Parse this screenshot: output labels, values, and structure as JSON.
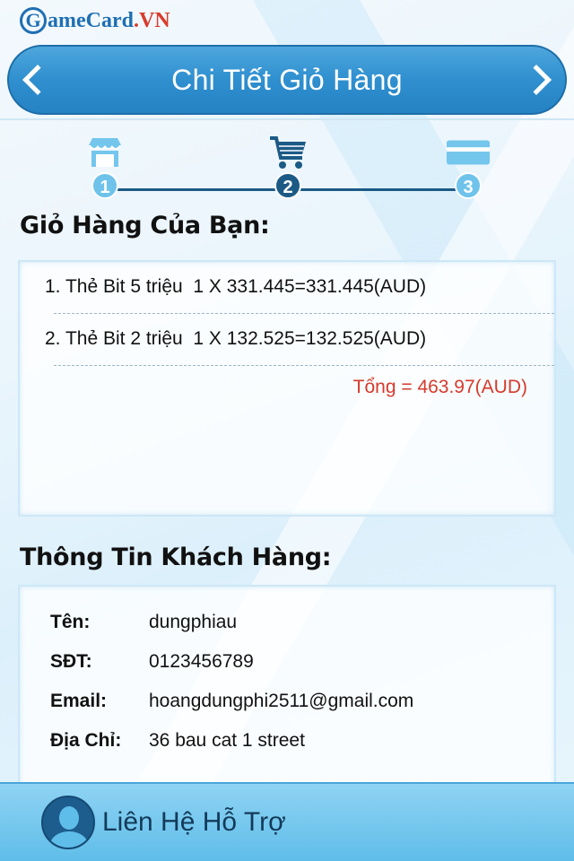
{
  "brand": {
    "logo_letter": "G",
    "logo_name": "ameCard",
    "logo_suffix": ".VN"
  },
  "header": {
    "title": "Chi Tiết Giỏ Hàng",
    "back_icon": "chevron-left-icon",
    "forward_icon": "chevron-right-icon"
  },
  "steps": [
    {
      "number": "1",
      "icon": "shop-icon",
      "state": "inactive"
    },
    {
      "number": "2",
      "icon": "cart-icon",
      "state": "active"
    },
    {
      "number": "3",
      "icon": "card-icon",
      "state": "inactive"
    }
  ],
  "cart": {
    "title": "Giỏ Hàng Của Bạn:",
    "items": [
      "1. Thẻ Bit 5 triệu  1 X 331.445=331.445(AUD)",
      "2. Thẻ Bit 2 triệu  1 X 132.525=132.525(AUD)"
    ],
    "total": "Tổng = 463.97(AUD)",
    "total_color": "#d63a2c"
  },
  "customer": {
    "title": "Thông Tin Khách Hàng:",
    "rows": [
      {
        "label": "Tên:",
        "value": "dungphiau"
      },
      {
        "label": "SĐT:",
        "value": "0123456789"
      },
      {
        "label": "Email:",
        "value": "hoangdungphi2511@gmail.com"
      },
      {
        "label": "Địa Chỉ:",
        "value": "36 bau cat 1 street"
      }
    ]
  },
  "footer": {
    "support_label": "Liên Hệ Hỗ Trợ",
    "icon": "support-agent-icon"
  },
  "colors": {
    "header": "#2f8fcf",
    "step_active": "#1c5a86",
    "step_inactive": "#6fc3ea",
    "footer": "#5fbde9"
  }
}
